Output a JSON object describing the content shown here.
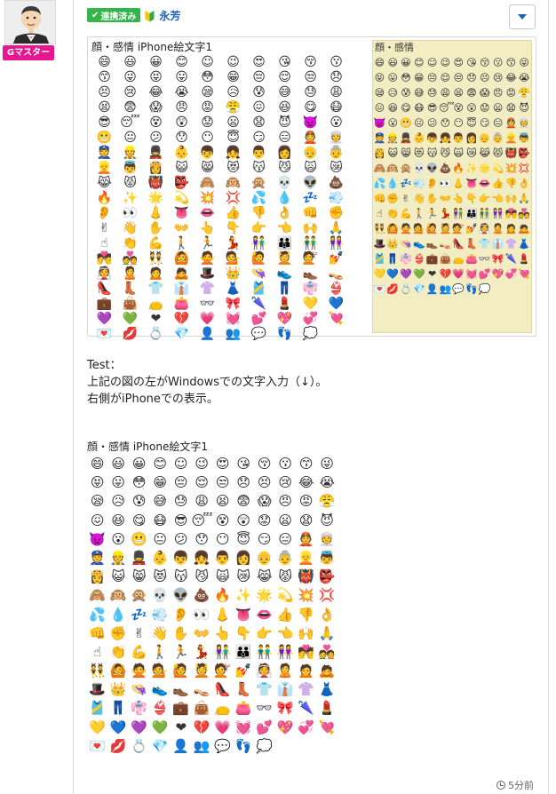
{
  "user": {
    "badge": "Gマスター",
    "linked_label": "連携済み",
    "linked_check": "✔",
    "name": "永芳"
  },
  "image": {
    "left_title": "顔・感情 iPhone絵文字1",
    "right_title": "顔・感情"
  },
  "post": {
    "lines": [
      "Test：",
      "上記の図の左がWindowsでの文字入力（↓）。",
      "右側がiPhoneでの表示。"
    ],
    "emoji_title": "顔・感情 iPhone絵文字1"
  },
  "timestamp": "5分前",
  "emoji_set": "😄😃😀😊☺😉😍😘😚😗😙😜😝😛😳😁😔😌😒😞😣😢😂😭😪😥😰😅😓😩😫😨😱😠😡😤😖😆😋😷😎😴😵😲😟😦😧😈👿😮😬😐😕😯😶😇😏😑👲👳👮👷💂👶👦👧👨👩👴👵👱👼👸😺😸😻😽😼🙀😿😹😾👹👺🙈🙉🙊💀👽💩🔥✨🌟💫💥💢💦💧💤💨👂👀👃👅👄👍👎👌👊✊✌👋✋👐👆👇👉👈🙌🙏☝👏💪🚶🏃💃👫👪👬👭💏💑👯🙆🙅💁🙋💆💇💅👰🙎🙍🙇🎩👑👒👟👞👡👠👢👕👔👚👗🎽👖👘👙💼👜👝👛👓🎀🌂💄💛💙💜💚❤💔💗💓💕💖💞💘💌💋💍💎👤👥💬👣💭"
}
